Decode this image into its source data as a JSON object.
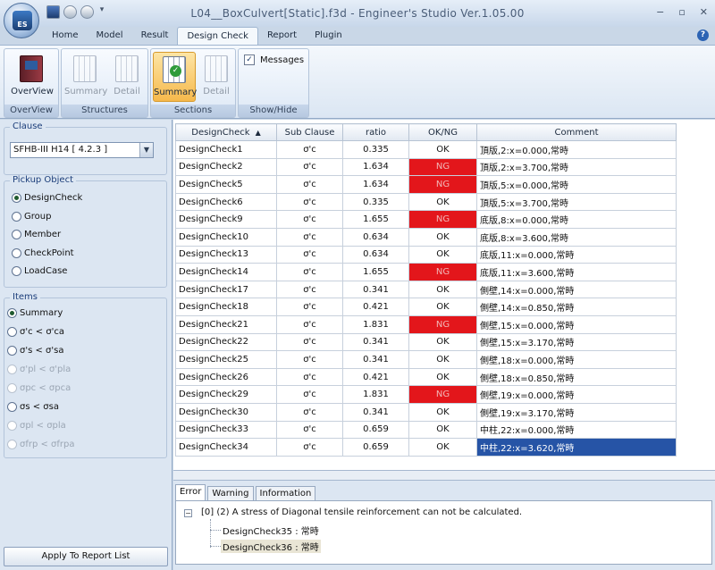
{
  "window": {
    "title": "L04__BoxCulvert[Static].f3d - Engineer's Studio Ver.1.05.00",
    "app_logo_text": "ES"
  },
  "ribbon_tabs": [
    "Home",
    "Model",
    "Result",
    "Design Check",
    "Report",
    "Plugin"
  ],
  "ribbon": {
    "overview": {
      "button": "OverView",
      "group": "OverView"
    },
    "structures": {
      "summary": "Summary",
      "detail": "Detail",
      "group": "Structures"
    },
    "sections": {
      "summary": "Summary",
      "detail": "Detail",
      "group": "Sections"
    },
    "showhide": {
      "messages": "Messages",
      "messages_checked": true,
      "group": "Show/Hide"
    }
  },
  "left_panel": {
    "clause": {
      "title": "Clause",
      "value": "SFHB-III H14 [ 4.2.3 ]"
    },
    "pickup": {
      "title": "Pickup Object",
      "options": [
        "DesignCheck",
        "Group",
        "Member",
        "CheckPoint",
        "LoadCase"
      ],
      "selected": "DesignCheck"
    },
    "items": {
      "title": "Items",
      "options": [
        {
          "label": "Summary",
          "enabled": true,
          "selected": true
        },
        {
          "label": "σ'c < σ'ca",
          "enabled": true,
          "selected": false
        },
        {
          "label": "σ's < σ'sa",
          "enabled": true,
          "selected": false
        },
        {
          "label": "σ'pl < σ'pla",
          "enabled": false,
          "selected": false
        },
        {
          "label": "σpc < σpca",
          "enabled": false,
          "selected": false
        },
        {
          "label": "σs < σsa",
          "enabled": true,
          "selected": false
        },
        {
          "label": "σpl < σpla",
          "enabled": false,
          "selected": false
        },
        {
          "label": "σfrp < σfrpa",
          "enabled": false,
          "selected": false
        }
      ]
    },
    "apply_button": "Apply To Report List"
  },
  "grid": {
    "columns": [
      "DesignCheck",
      "Sub Clause",
      "ratio",
      "OK/NG",
      "Comment"
    ],
    "rows": [
      {
        "name": "DesignCheck1",
        "sub": "σ'c",
        "ratio": "0.335",
        "status": "OK",
        "comment": "頂版,2:x=0.000,常時"
      },
      {
        "name": "DesignCheck2",
        "sub": "σ'c",
        "ratio": "1.634",
        "status": "NG",
        "comment": "頂版,2:x=3.700,常時"
      },
      {
        "name": "DesignCheck5",
        "sub": "σ'c",
        "ratio": "1.634",
        "status": "NG",
        "comment": "頂版,5:x=0.000,常時"
      },
      {
        "name": "DesignCheck6",
        "sub": "σ'c",
        "ratio": "0.335",
        "status": "OK",
        "comment": "頂版,5:x=3.700,常時"
      },
      {
        "name": "DesignCheck9",
        "sub": "σ'c",
        "ratio": "1.655",
        "status": "NG",
        "comment": "底版,8:x=0.000,常時"
      },
      {
        "name": "DesignCheck10",
        "sub": "σ'c",
        "ratio": "0.634",
        "status": "OK",
        "comment": "底版,8:x=3.600,常時"
      },
      {
        "name": "DesignCheck13",
        "sub": "σ'c",
        "ratio": "0.634",
        "status": "OK",
        "comment": "底版,11:x=0.000,常時"
      },
      {
        "name": "DesignCheck14",
        "sub": "σ'c",
        "ratio": "1.655",
        "status": "NG",
        "comment": "底版,11:x=3.600,常時"
      },
      {
        "name": "DesignCheck17",
        "sub": "σ'c",
        "ratio": "0.341",
        "status": "OK",
        "comment": "側壁,14:x=0.000,常時"
      },
      {
        "name": "DesignCheck18",
        "sub": "σ'c",
        "ratio": "0.421",
        "status": "OK",
        "comment": "側壁,14:x=0.850,常時"
      },
      {
        "name": "DesignCheck21",
        "sub": "σ'c",
        "ratio": "1.831",
        "status": "NG",
        "comment": "側壁,15:x=0.000,常時"
      },
      {
        "name": "DesignCheck22",
        "sub": "σ'c",
        "ratio": "0.341",
        "status": "OK",
        "comment": "側壁,15:x=3.170,常時"
      },
      {
        "name": "DesignCheck25",
        "sub": "σ'c",
        "ratio": "0.341",
        "status": "OK",
        "comment": "側壁,18:x=0.000,常時"
      },
      {
        "name": "DesignCheck26",
        "sub": "σ'c",
        "ratio": "0.421",
        "status": "OK",
        "comment": "側壁,18:x=0.850,常時"
      },
      {
        "name": "DesignCheck29",
        "sub": "σ'c",
        "ratio": "1.831",
        "status": "NG",
        "comment": "側壁,19:x=0.000,常時"
      },
      {
        "name": "DesignCheck30",
        "sub": "σ'c",
        "ratio": "0.341",
        "status": "OK",
        "comment": "側壁,19:x=3.170,常時"
      },
      {
        "name": "DesignCheck33",
        "sub": "σ'c",
        "ratio": "0.659",
        "status": "OK",
        "comment": "中柱,22:x=0.000,常時"
      },
      {
        "name": "DesignCheck34",
        "sub": "σ'c",
        "ratio": "0.659",
        "status": "OK",
        "comment": "中柱,22:x=3.620,常時",
        "selected_comment": true
      }
    ],
    "colors": {
      "ng": "#e3161b",
      "selected": "#2654a6"
    }
  },
  "messages": {
    "tabs": [
      "Error",
      "Warning",
      "Information"
    ],
    "active_tab": "Error",
    "root": "[0] (2) A stress of Diagonal tensile reinforcement can not be calculated.",
    "children": [
      "DesignCheck35 : 常時",
      "DesignCheck36 : 常時"
    ]
  }
}
